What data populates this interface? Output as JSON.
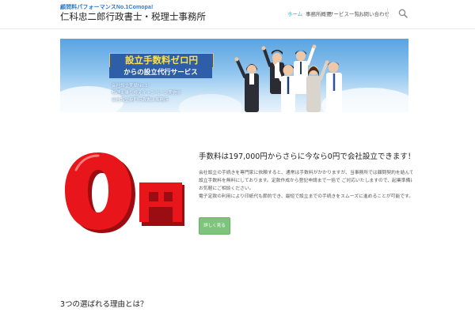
{
  "header": {
    "logo_tagline": "顧問料パフォーマンスNo.1Comopa!",
    "logo_name": "仁科忠二郎行政書士・税理士事務所",
    "nav": [
      {
        "label": "ホーム",
        "active": true
      },
      {
        "label": "事務所概要",
        "active": false
      },
      {
        "label": "サービス一覧",
        "active": false,
        "has_dropdown": true
      },
      {
        "label": "お問い合わせ",
        "active": false
      }
    ],
    "search_icon": "search-icon"
  },
  "banner": {
    "title": "設立手数料ゼロ円",
    "subtitle": "からの設立代行サービス",
    "points": [
      "会社設立実績No.1！",
      "税理士乗り換えキャンペーン実施中",
      "会社設立専門行政書士事務所"
    ]
  },
  "feature": {
    "graphic_text": "0円",
    "heading": "手数料は197,000円からさらに今なら0円で会社設立できます！",
    "body_lines": [
      "会社設立の手続きを専門家に依頼すると、通常は手数料がかかりますが、当事務所では顧問契約を結んでいただくことを条件に",
      "設立手数料を無料にしております。定款作成から登記申請まで一括で ご対応いたしますので、起業準備に専念していただけます。",
      "お気軽にご相談ください。",
      "電子定款の利用により印紙代も節約でき、最短で設立までの手続きをスムーズに進めることが可能です。詳しくはこちら。"
    ],
    "button_label": "詳しく見る"
  },
  "section": {
    "heading": "3つの選ばれる理由とは？"
  },
  "colors": {
    "accent": "#29b6c6",
    "button": "#7dc47d",
    "logo_blue": "#2e78c8",
    "zero_red": "#e8151b"
  }
}
